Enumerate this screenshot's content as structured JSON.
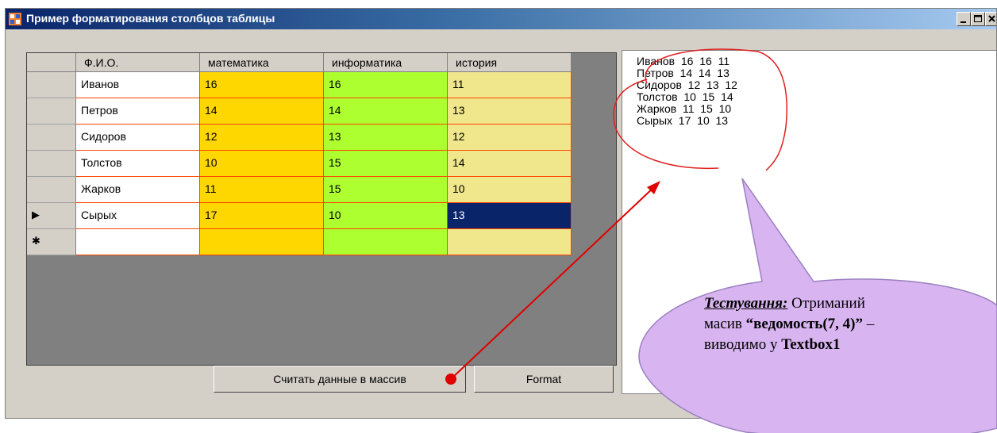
{
  "window": {
    "title": "Пример форматирования столбцов таблицы"
  },
  "colors": {
    "fio": "#ffffff",
    "math": "#ffd700",
    "info": "#adff2f",
    "hist": "#f0e68c",
    "selected": "#0a246a",
    "border": "#ff4500"
  },
  "grid": {
    "headers": [
      "Ф.И.О.",
      "математика",
      "информатика",
      "история"
    ],
    "rows": [
      {
        "marker": "",
        "cells": [
          "Иванов",
          "16",
          "16",
          "11"
        ]
      },
      {
        "marker": "",
        "cells": [
          "Петров",
          "14",
          "14",
          "13"
        ]
      },
      {
        "marker": "",
        "cells": [
          "Сидоров",
          "12",
          "13",
          "12"
        ]
      },
      {
        "marker": "",
        "cells": [
          "Толстов",
          "10",
          "15",
          "14"
        ]
      },
      {
        "marker": "",
        "cells": [
          "Жарков",
          "11",
          "15",
          "10"
        ]
      },
      {
        "marker": "▶",
        "cells": [
          "Сырых",
          "17",
          "10",
          "13"
        ]
      },
      {
        "marker": "✱",
        "cells": [
          "",
          "",
          "",
          ""
        ]
      }
    ]
  },
  "buttons": {
    "read": "Считать данные в массив",
    "format": "Format"
  },
  "textbox": {
    "lines": [
      "Иванов  16  16  11",
      "Петров  14  14  13",
      "Сидоров  12  13  12",
      "Толстов  10  15  14",
      "Жарков  11  15  10",
      "Сырых  17  10  13"
    ]
  },
  "callout": {
    "label": "Тестування:",
    "text1": " Отриманий",
    "text2a": "масив ",
    "text2b": "“ведомость(7, 4)”",
    "text2c": " –",
    "text3a": "виводимо у ",
    "text3b": "Textbox1"
  }
}
